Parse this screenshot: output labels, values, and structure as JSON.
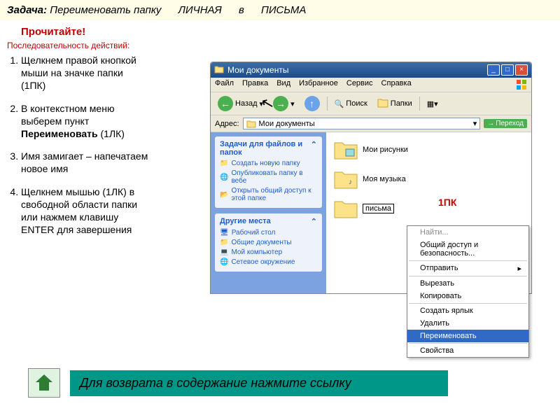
{
  "task": {
    "label": "Задача:",
    "text": "Переименовать папку",
    "from": "ЛИЧНАЯ",
    "mid": "в",
    "to": "ПИСЬМА"
  },
  "readit": "Прочитайте!",
  "sequence": "Последовательность действий:",
  "steps": [
    "Щелкнем правой кнопкой мыши на значке папки (1ПК)",
    "В контекстном меню выберем пункт Переименовать (1ЛК)",
    "Имя замигает – напечатаем новое имя",
    "Щелкнем мышью (1ЛК) в свободной области папки или нажмем клавишу ENTER для завершения"
  ],
  "window": {
    "title": "Мои документы",
    "menu": [
      "Файл",
      "Правка",
      "Вид",
      "Избранное",
      "Сервис",
      "Справка"
    ],
    "toolbar": {
      "back": "Назад",
      "search": "Поиск",
      "folders": "Папки"
    },
    "address": {
      "label": "Адрес:",
      "value": "Мои документы",
      "go": "Переход"
    },
    "sidepanel": {
      "tasks_title": "Задачи для файлов и папок",
      "tasks": [
        "Создать новую папку",
        "Опубликовать папку в вебе",
        "Открыть общий доступ к этой папке"
      ],
      "places_title": "Другие места",
      "places": [
        "Рабочий стол",
        "Общие документы",
        "Мой компьютер",
        "Сетевое окружение"
      ]
    },
    "folders": {
      "f1": "Мои рисунки",
      "f2": "Моя музыка",
      "f3_edit": "письма"
    },
    "label1pk": "1ПК",
    "context": {
      "find": "Найти...",
      "access": "Общий доступ и безопасность...",
      "send": "Отправить",
      "cut": "Вырезать",
      "copy": "Копировать",
      "shortcut": "Создать ярлык",
      "delete": "Удалить",
      "rename": "Переименовать",
      "props": "Свойства"
    }
  },
  "footer": "Для возврата в содержание нажмите ссылку"
}
